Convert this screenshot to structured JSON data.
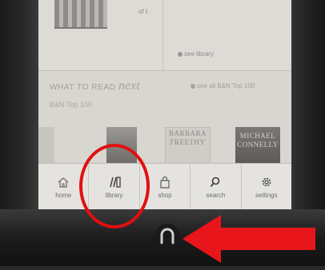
{
  "top_panel": {
    "progress_text": "of t",
    "see_library_label": "see library"
  },
  "what_to_read": {
    "title_prefix": "WHAT TO READ",
    "title_suffix": "next",
    "see_all_label": "see all B&N Top 100",
    "list_name": "B&N Top 100",
    "covers": [
      {
        "text": ""
      },
      {
        "text": ""
      },
      {
        "text": "BARBARA FREETHY"
      },
      {
        "text": "MICHAEL CONNELLY"
      }
    ]
  },
  "nav": {
    "items": [
      {
        "label": "home",
        "icon": "home-icon"
      },
      {
        "label": "library",
        "icon": "library-icon"
      },
      {
        "label": "shop",
        "icon": "shop-icon"
      },
      {
        "label": "search",
        "icon": "search-icon"
      },
      {
        "label": "settings",
        "icon": "settings-icon"
      }
    ]
  },
  "annotation": {
    "highlight_color": "#e01010",
    "arrow_color": "#e8161a",
    "highlighted_item": "library",
    "pointed_at": "n-button"
  },
  "colors": {
    "screen_bg": "#d9d7d1",
    "nav_bg": "#e4e3df",
    "case": "#1f1f1f"
  }
}
